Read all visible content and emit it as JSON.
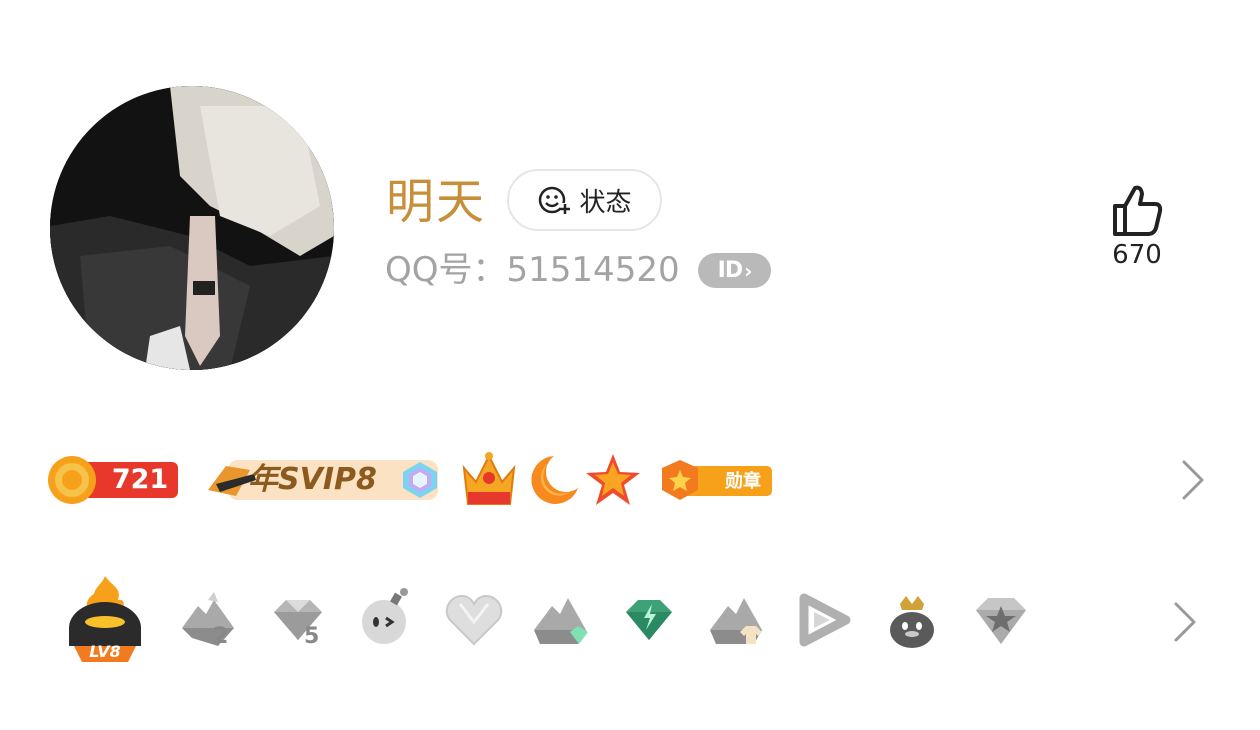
{
  "profile": {
    "name": "明天",
    "status_label": "状态",
    "qq_label": "QQ号：",
    "qq_number": "51514520",
    "id_badge": "ID",
    "likes": "670"
  },
  "badges_row": {
    "coin_count": "721",
    "svip_label": "年SVIP8",
    "medal_label": "勋章",
    "icons": [
      "coin-icon",
      "svip-icon",
      "diamond-icon",
      "crown-icon",
      "moon-icon",
      "star-icon",
      "medal-icon"
    ]
  },
  "level_row": {
    "level_label": "LV8",
    "num_a": "2",
    "num_b": "5",
    "icons": [
      "flame-penguin-icon",
      "mountain-icon",
      "gem-icon",
      "bomb-icon",
      "heart-icon",
      "gem-mountain-icon",
      "green-gem-icon",
      "mountain-shirt-icon",
      "play-icon",
      "crown-penguin-icon",
      "diamond-star-icon"
    ]
  },
  "colors": {
    "name": "#c88f3a",
    "accent_red": "#e8372b",
    "gold": "#f7a11b",
    "gray": "#a3a3a3"
  }
}
